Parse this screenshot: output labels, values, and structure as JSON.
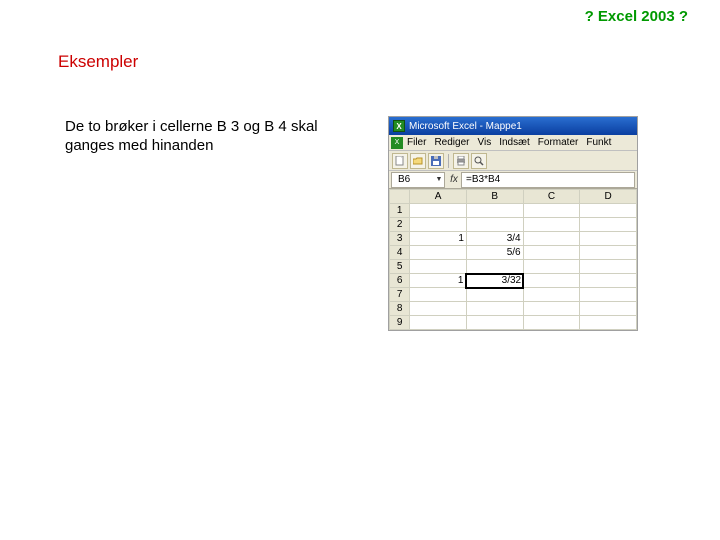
{
  "header": {
    "title": "? Excel 2003 ?"
  },
  "section": {
    "heading": "Eksempler"
  },
  "body": {
    "text": "De to brøker i cellerne B 3 og B 4 skal ganges med hinanden"
  },
  "excel": {
    "titlebar": "Microsoft Excel - Mappe1",
    "menus": [
      "Filer",
      "Rediger",
      "Vis",
      "Indsæt",
      "Formater",
      "Funkt"
    ],
    "formula": {
      "namebox": "B6",
      "value": "=B3*B4"
    },
    "columns": [
      "A",
      "B",
      "C",
      "D"
    ],
    "rows": [
      "1",
      "2",
      "3",
      "4",
      "5",
      "6",
      "7",
      "8",
      "9"
    ],
    "cells": {
      "A3": "1",
      "B3": "3/4",
      "B4": "5/6",
      "A6": "1",
      "B6": "3/32"
    }
  }
}
